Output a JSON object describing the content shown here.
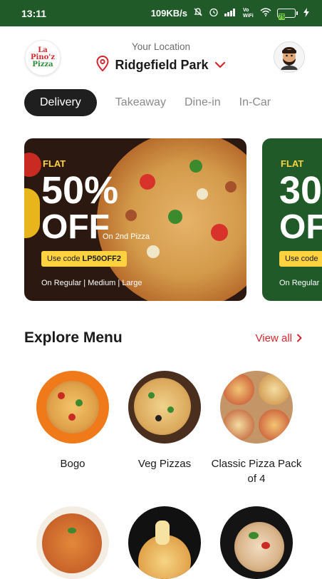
{
  "status_bar": {
    "time": "13:11",
    "network_speed": "109KB/s",
    "signal_label": "Vo WiFi",
    "battery_level": "75"
  },
  "header": {
    "logo_line1": "La Pino'z",
    "logo_line2": "Pizza",
    "location_label": "Your Location",
    "location_name": "Ridgefield Park"
  },
  "tabs": [
    {
      "label": "Delivery",
      "active": true
    },
    {
      "label": "Takeaway",
      "active": false
    },
    {
      "label": "Dine-in",
      "active": false
    },
    {
      "label": "In-Car",
      "active": false
    }
  ],
  "banners": [
    {
      "flat": "FLAT",
      "big": "50%",
      "off": "OFF",
      "sub": "On 2nd Pizza",
      "code_prefix": "Use code ",
      "code": "LP50OFF2",
      "footer": "On Regular | Medium | Large"
    },
    {
      "flat": "FLAT",
      "big": "30",
      "off": "OF",
      "code_prefix": "Use code",
      "footer": "On Regular"
    }
  ],
  "explore": {
    "title": "Explore Menu",
    "view_all": "View all"
  },
  "menu_items": [
    {
      "label": "Bogo"
    },
    {
      "label": "Veg Pizzas"
    },
    {
      "label": "Classic Pizza Pack of 4"
    }
  ],
  "colors": {
    "status_bar": "#1f5a28",
    "accent_red": "#d7262e",
    "promo_yellow": "#ffd23f",
    "active_tab": "#1f1f1f"
  }
}
